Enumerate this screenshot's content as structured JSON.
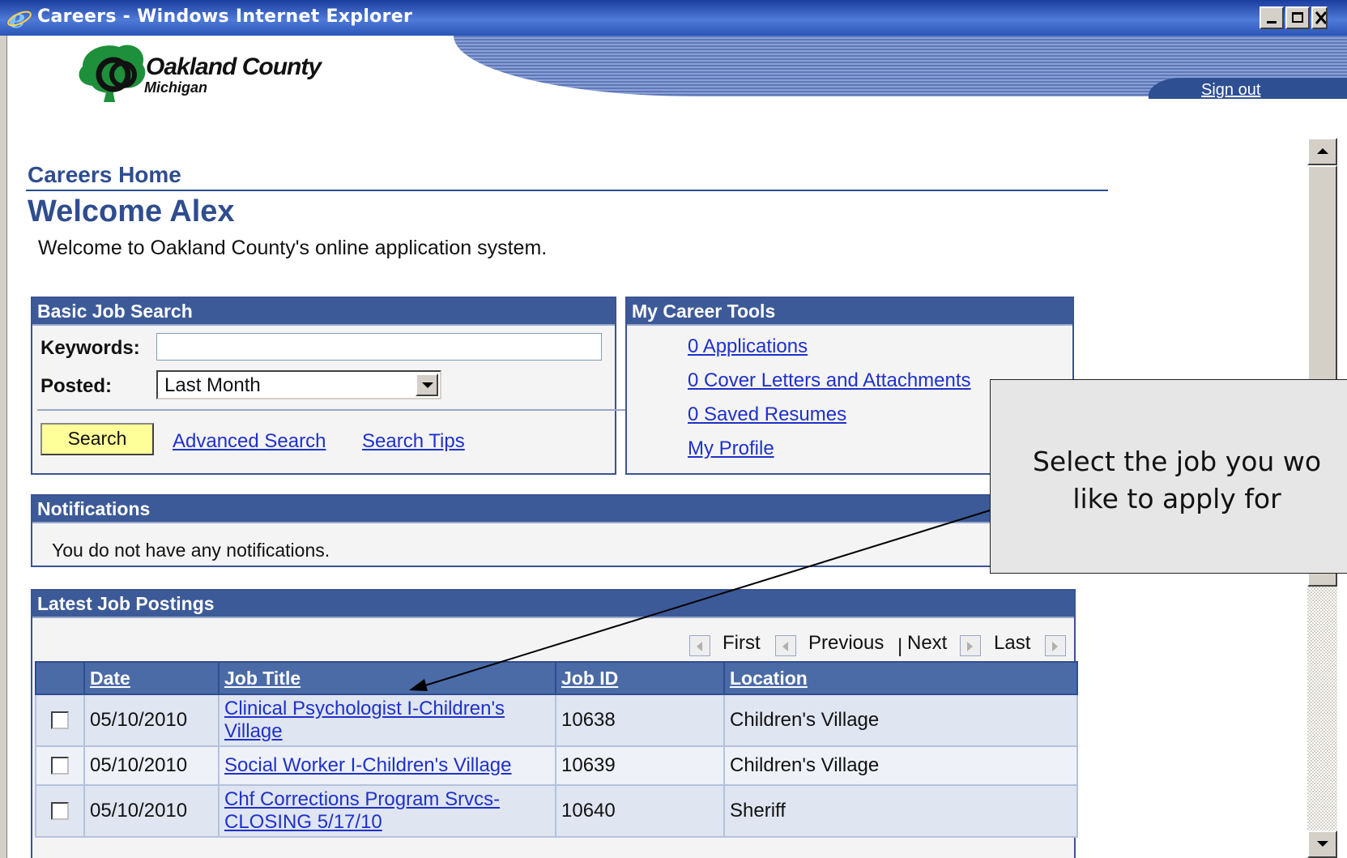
{
  "window": {
    "title": "Careers - Windows Internet Explorer"
  },
  "header": {
    "logo_title": "Oakland County",
    "logo_sub": "Michigan",
    "sign_out": "Sign out"
  },
  "page": {
    "breadcrumb": "Careers Home",
    "welcome_title": "Welcome Alex",
    "welcome_text": "Welcome to Oakland County's online application system."
  },
  "basic_search": {
    "heading": "Basic Job Search",
    "keywords_label": "Keywords:",
    "keywords_value": "",
    "posted_label": "Posted:",
    "posted_value": "Last Month",
    "search_button": "Search",
    "advanced_link": "Advanced Search",
    "tips_link": "Search Tips"
  },
  "career_tools": {
    "heading": "My Career Tools",
    "links": [
      "0 Applications",
      "0 Cover Letters and Attachments",
      "0 Saved Resumes",
      "My Profile"
    ]
  },
  "notifications": {
    "heading": "Notifications",
    "message": "You do not have any notifications."
  },
  "postings": {
    "heading": "Latest Job Postings",
    "pager": {
      "first": "First",
      "previous": "Previous",
      "separator": "|",
      "next": "Next",
      "last": "Last"
    },
    "columns": [
      "Date",
      "Job Title",
      "Job ID",
      "Location"
    ],
    "rows": [
      {
        "date": "05/10/2010",
        "title": "Clinical Psychologist I-Children's Village",
        "job_id": "10638",
        "location": "Children's Village"
      },
      {
        "date": "05/10/2010",
        "title": "Social Worker I-Children's Village",
        "job_id": "10639",
        "location": "Children's Village"
      },
      {
        "date": "05/10/2010",
        "title": "Chf Corrections Program Srvcs-CLOSING 5/17/10",
        "job_id": "10640",
        "location": "Sheriff"
      }
    ]
  },
  "callout": {
    "line1": "Select the job you wo",
    "line2": "like to apply for"
  },
  "colors": {
    "titlebar": "#2a55b8",
    "panel_header": "#3d5a98",
    "link": "#1f31c9",
    "search_button": "#ffff99"
  },
  "icons": [
    "ie-logo-icon",
    "minimize-icon",
    "maximize-icon",
    "close-icon",
    "oak-tree-logo",
    "dropdown-arrow-icon",
    "first-page-icon",
    "previous-page-icon",
    "next-page-icon",
    "last-page-icon",
    "scroll-up-icon",
    "scroll-down-icon"
  ]
}
